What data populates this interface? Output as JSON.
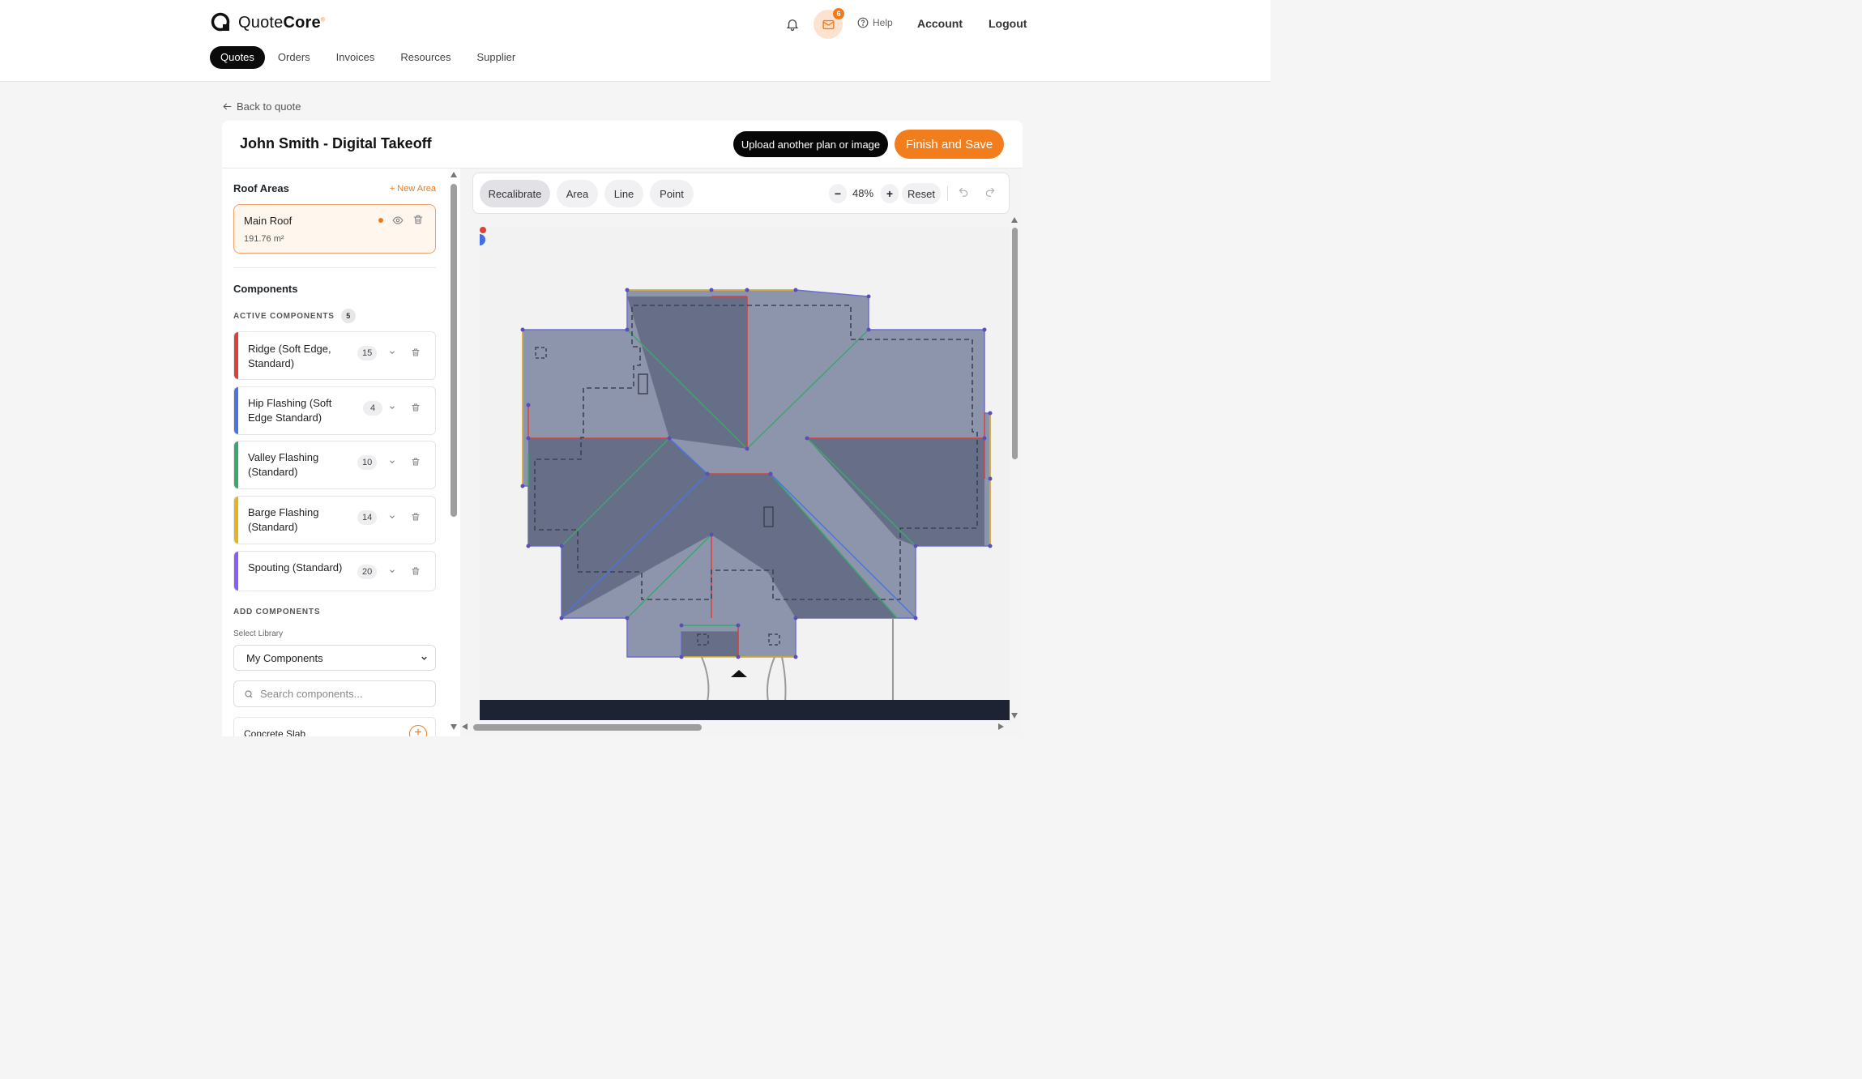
{
  "app": {
    "brand_light": "Quote",
    "brand_bold": "Core",
    "brand_reg": "®",
    "accent": "#f27d1c",
    "notifications_icon": "bell-icon",
    "mail_icon": "mail-icon",
    "mail_count": "6",
    "help_label": "Help",
    "account_label": "Account",
    "logout_label": "Logout"
  },
  "nav": {
    "tabs": [
      {
        "label": "Quotes",
        "active": true
      },
      {
        "label": "Orders"
      },
      {
        "label": "Invoices"
      },
      {
        "label": "Resources"
      },
      {
        "label": "Supplier"
      }
    ]
  },
  "back_label": "Back to quote",
  "header": {
    "title": "John Smith - Digital Takeoff",
    "upload_label": "Upload another plan or image",
    "finish_label": "Finish and Save"
  },
  "sidebar": {
    "roof_areas_title": "Roof Areas",
    "new_area_label": "+ New Area",
    "roof": {
      "name": "Main Roof",
      "area": "191.76 m²"
    },
    "components_title": "Components",
    "active_label": "ACTIVE COMPONENTS",
    "active_count": "5",
    "components": [
      {
        "name": "Ridge (Soft Edge, Standard)",
        "qty": "15",
        "color": "#d9413a"
      },
      {
        "name": "Hip Flashing (Soft Edge Standard)",
        "qty": "4",
        "color": "#4a74e0"
      },
      {
        "name": "Valley Flashing (Standard)",
        "qty": "10",
        "color": "#3aa76d"
      },
      {
        "name": "Barge Flashing (Standard)",
        "qty": "14",
        "color": "#e6b422"
      },
      {
        "name": "Spouting (Standard)",
        "qty": "20",
        "color": "#8b5cf6"
      }
    ],
    "add_label": "ADD COMPONENTS",
    "select_library_label": "Select Library",
    "library_value": "My Components",
    "search_placeholder": "Search components...",
    "library_items": [
      {
        "name": "Concrete Slab"
      }
    ]
  },
  "toolbar": {
    "tools": [
      "Recalibrate",
      "Area",
      "Line",
      "Point"
    ],
    "zoom_out": "−",
    "zoom": "48%",
    "zoom_in": "+",
    "reset": "Reset",
    "undo_icon": "undo-icon",
    "redo_icon": "redo-icon"
  }
}
